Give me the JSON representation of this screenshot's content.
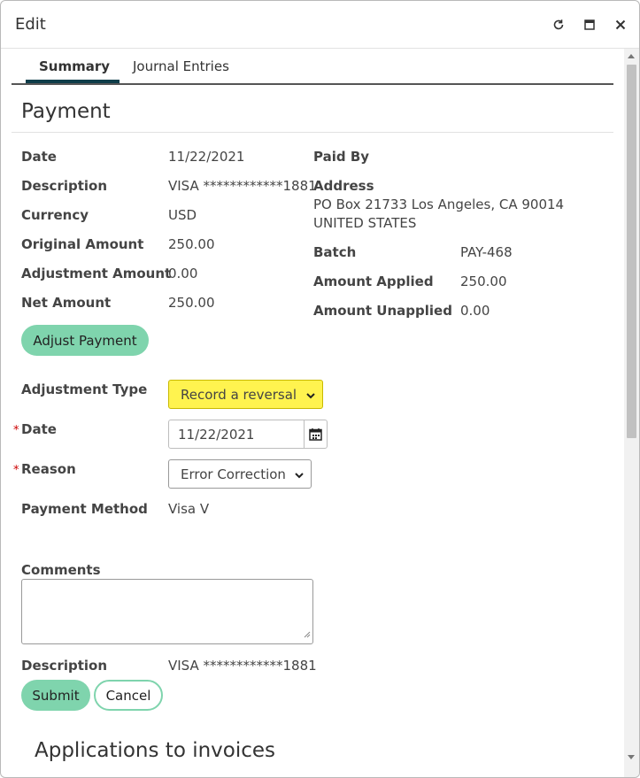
{
  "window": {
    "title": "Edit"
  },
  "tabs": [
    {
      "label": "Summary"
    },
    {
      "label": "Journal Entries"
    }
  ],
  "section_title": "Payment",
  "left_fields": [
    {
      "label": "Date",
      "value": "11/22/2021"
    },
    {
      "label": "Description",
      "value": "VISA ************1881"
    },
    {
      "label": "Currency",
      "value": "USD"
    },
    {
      "label": "Original Amount",
      "value": "250.00"
    },
    {
      "label": "Adjustment Amount",
      "value": "0.00"
    },
    {
      "label": "Net Amount",
      "value": "250.00"
    }
  ],
  "right_fields": {
    "paid_by_label": "Paid By",
    "address_label": "Address",
    "address_value": "PO Box 21733 Los Angeles, CA 90014 UNITED STATES",
    "batch_label": "Batch",
    "batch_value": "PAY-468",
    "applied_label": "Amount Applied",
    "applied_value": "250.00",
    "unapplied_label": "Amount Unapplied",
    "unapplied_value": "0.00"
  },
  "adjust_button": "Adjust Payment",
  "adjustment": {
    "type_label": "Adjustment Type",
    "type_value": "Record a reversal",
    "type_highlight": "#fff34f",
    "date_label": "Date",
    "date_value": "11/22/2021",
    "reason_label": "Reason",
    "reason_value": "Error Correction",
    "required_marker": "*",
    "method_label": "Payment Method",
    "method_value": "Visa V",
    "comments_label": "Comments",
    "comments_value": "",
    "description_label": "Description",
    "description_value": "VISA ************1881"
  },
  "actions": {
    "submit": "Submit",
    "cancel": "Cancel"
  },
  "applications_title": "Applications to invoices",
  "colors": {
    "accent": "#7fd4ad",
    "tab_underline": "#0f3d4a",
    "required": "#cc0000"
  }
}
